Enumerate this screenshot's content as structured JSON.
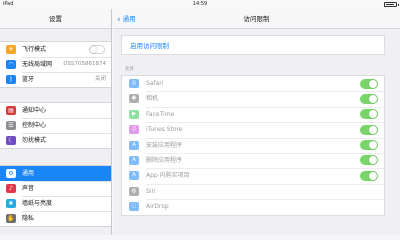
{
  "status_bar": {
    "device": "iPad",
    "time": "14:59"
  },
  "settings_sidebar": {
    "title": "设置",
    "groups": [
      [
        {
          "label": "飞行模式",
          "icon": "airplane-icon",
          "color": "#f5a623",
          "toggle": "off"
        },
        {
          "label": "无线局域网",
          "icon": "wifi-icon",
          "color": "#1a85f7",
          "value": "DSS705861874"
        },
        {
          "label": "蓝牙",
          "icon": "bluetooth-icon",
          "color": "#1a85f7",
          "value": "关闭"
        }
      ],
      [
        {
          "label": "通知中心",
          "icon": "notification-icon",
          "color": "#d83a3a"
        },
        {
          "label": "控制中心",
          "icon": "control-center-icon",
          "color": "#8e8e93"
        },
        {
          "label": "勿扰模式",
          "icon": "do-not-disturb-icon",
          "color": "#6f4cc3"
        }
      ],
      [
        {
          "label": "通用",
          "icon": "gear-icon",
          "color": "#8e8e93",
          "selected": true
        },
        {
          "label": "声音",
          "icon": "sound-icon",
          "color": "#e0394e"
        },
        {
          "label": "墙纸与亮度",
          "icon": "wallpaper-icon",
          "color": "#25a9e0"
        },
        {
          "label": "隐私",
          "icon": "privacy-icon",
          "color": "#6e6e73"
        }
      ]
    ]
  },
  "detail": {
    "back_label": "通用",
    "title": "访问限制",
    "enable_label": "启用访问限制",
    "allow_header": "允许",
    "allow_items": [
      {
        "label": "Safari",
        "icon": "safari-icon",
        "color": "#1a85f7",
        "enabled": true
      },
      {
        "label": "相机",
        "icon": "camera-icon",
        "color": "#6e6e73",
        "enabled": true
      },
      {
        "label": "FaceTime",
        "icon": "facetime-icon",
        "color": "#34c759",
        "enabled": true
      },
      {
        "label": "iTunes Store",
        "icon": "itunes-icon",
        "color": "#cc4bd6",
        "enabled": true
      },
      {
        "label": "安装应用程序",
        "icon": "app-store-icon",
        "color": "#1a85f7",
        "enabled": true
      },
      {
        "label": "删除应用程序",
        "icon": "delete-app-icon",
        "color": "#1a85f7",
        "enabled": true
      },
      {
        "label": "App 内购买项目",
        "icon": "in-app-purchase-icon",
        "color": "#1a85f7",
        "enabled": true
      },
      {
        "label": "Siri",
        "icon": "siri-icon",
        "color": "#6e6e73",
        "enabled": false
      },
      {
        "label": "AirDrop",
        "icon": "airdrop-icon",
        "color": "#1a85f7",
        "enabled": false
      }
    ]
  }
}
